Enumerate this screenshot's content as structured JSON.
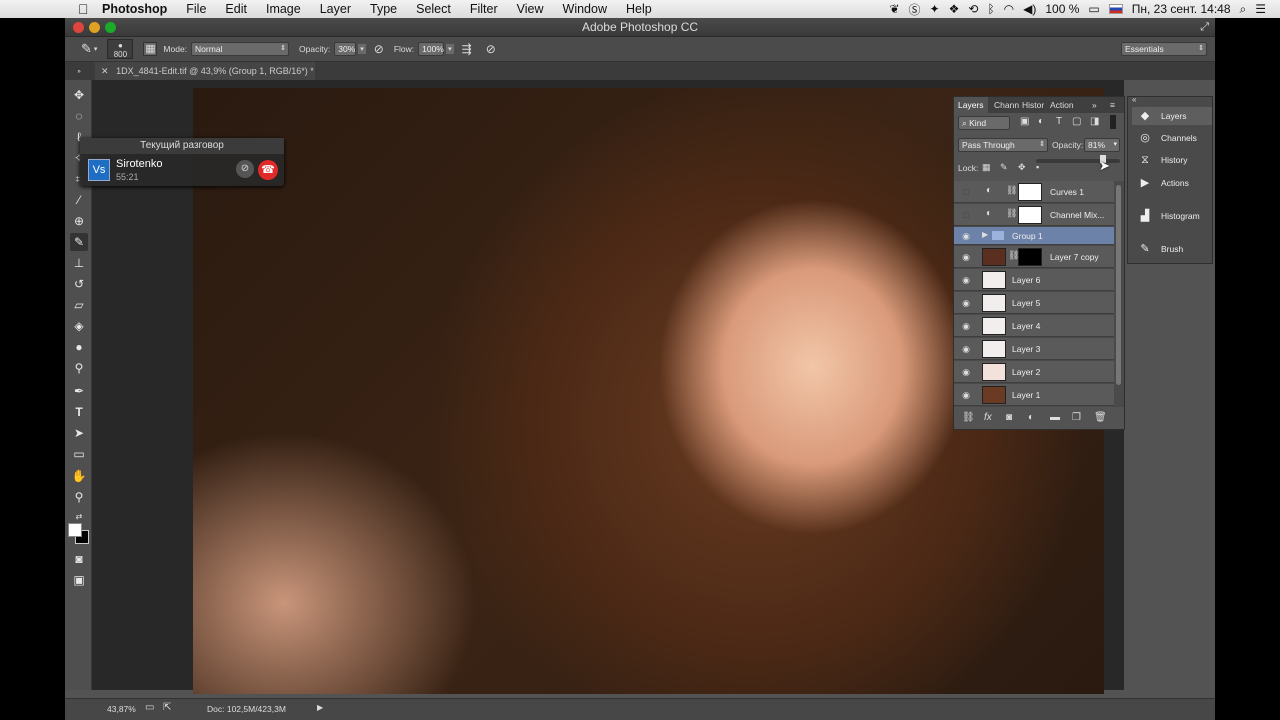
{
  "menubar": {
    "apple_icon": "apple-icon",
    "items": [
      "Photoshop",
      "File",
      "Edit",
      "Image",
      "Layer",
      "Type",
      "Select",
      "Filter",
      "View",
      "Window",
      "Help"
    ],
    "battery": "100 %",
    "datetime": "Пн, 23 сент.  14:48"
  },
  "window": {
    "title": "Adobe Photoshop CC"
  },
  "options": {
    "brush_size": "800",
    "mode_label": "Mode:",
    "mode_value": "Normal",
    "opacity_label": "Opacity:",
    "opacity_value": "30%",
    "flow_label": "Flow:",
    "flow_value": "100%",
    "workspace": "Essentials"
  },
  "document": {
    "tab_label": "1DX_4841-Edit.tif @ 43,9% (Group 1, RGB/16*) *"
  },
  "statusbar": {
    "zoom": "43,87%",
    "doc": "Doc: 102,5M/423,3M"
  },
  "call": {
    "header": "Текущий разговор",
    "avatar_text": "Vs",
    "name": "Sirotenko",
    "duration": "55:21"
  },
  "layers_panel": {
    "tabs": [
      "Layers",
      "Chann",
      "Histor",
      "Action"
    ],
    "filter_kind": "Kind",
    "blend_mode": "Pass Through",
    "opacity_label": "Opacity:",
    "opacity_value": "81%",
    "lock_label": "Lock:",
    "rows": [
      {
        "name": "Curves 1",
        "visible": false
      },
      {
        "name": "Channel Mix...",
        "visible": false
      },
      {
        "name": "Group 1",
        "visible": true,
        "selected": true
      },
      {
        "name": "Layer 7 copy",
        "visible": true
      },
      {
        "name": "Layer 6",
        "visible": true
      },
      {
        "name": "Layer 5",
        "visible": true
      },
      {
        "name": "Layer 4",
        "visible": true
      },
      {
        "name": "Layer 3",
        "visible": true
      },
      {
        "name": "Layer 2",
        "visible": true
      },
      {
        "name": "Layer 1",
        "visible": true
      }
    ]
  },
  "dock": {
    "items": [
      "Layers",
      "Channels",
      "History",
      "Actions",
      "Histogram",
      "Brush"
    ]
  },
  "colors": {
    "selected_layer": "#6d82a8",
    "call_end": "#e02a2a",
    "skype_blue": "#1e6fc4"
  }
}
